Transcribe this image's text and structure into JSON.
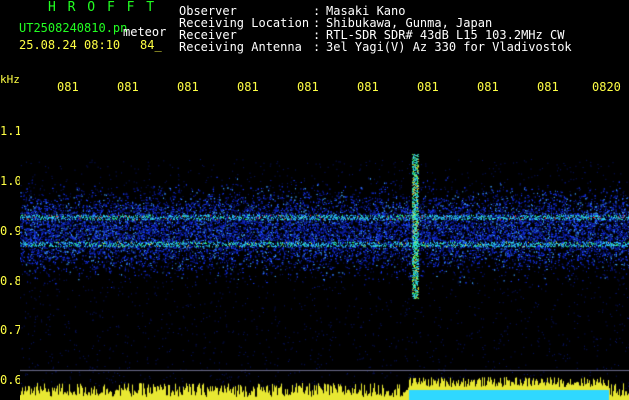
{
  "header": {
    "brand": "H R O F F T",
    "filename": "UT2508240810.pn",
    "tag": "meteor",
    "datetime": "25.08.24 08:10",
    "count": "84_"
  },
  "meta": [
    {
      "label": "Observer",
      "value": "Masaki Kano"
    },
    {
      "label": "Receiving Location",
      "value": "Shibukawa, Gunma, Japan"
    },
    {
      "label": "Receiver",
      "value": "RTL-SDR SDR# 43dB L15 103.2MHz CW"
    },
    {
      "label": "Receiving Antenna",
      "value": "3el Yagi(V) Az 330 for Vladivostok"
    }
  ],
  "axis": {
    "y_unit": "kHz",
    "x_ticks": [
      "081",
      "081",
      "081",
      "081",
      "081",
      "081",
      "081",
      "081",
      "081",
      "0820"
    ],
    "y_ticks": [
      "1.1",
      "1.0",
      "0.9",
      "0.8",
      "0.7",
      "0.6"
    ]
  },
  "colors": {
    "background": "#000000",
    "header_green": "#22ff22",
    "tick_yellow": "#ffff44",
    "noise_blue": "#1a3cff",
    "signal_cyan": "#2fe0ff",
    "signal_hot": "#ff3020"
  }
}
